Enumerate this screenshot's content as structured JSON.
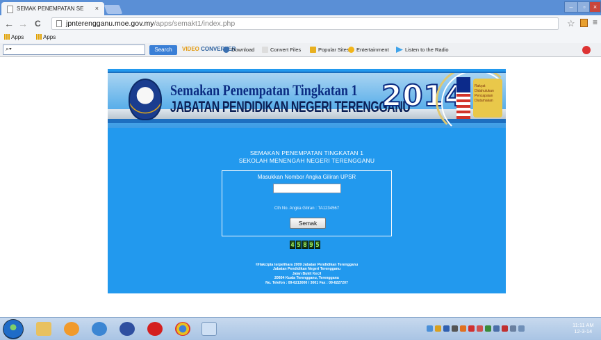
{
  "browser": {
    "tab_title": "SEMAK PENEMPATAN SE",
    "tab_close": "×",
    "url_host": "jpnterengganu.moe.gov.my",
    "url_path": "/apps/semakt1/index.php",
    "back": "←",
    "forward": "→",
    "reload": "C",
    "star": "☆",
    "menu": "≡",
    "bookmarks": [
      "Apps",
      "Apps"
    ]
  },
  "toolbar": {
    "search_box_value": "⌕▾",
    "search_label": "Search",
    "vc_logo_a": "VIDEO",
    "vc_logo_b": "CONVERTER",
    "download": "Download",
    "convert_files": "Convert Files",
    "popular_sites": "Popular Sites",
    "entertainment": "Entertainment",
    "listen_radio": "Listen to the Radio"
  },
  "banner": {
    "title1": "Semakan Penempatan Tingkatan 1",
    "title2": "JABATAN PENDIDIKAN NEGERI TERENGGANU",
    "year": "2014",
    "badge": "Rakyat Didahulukan Pencapaian Diutamakan"
  },
  "page": {
    "heading1": "SEMAKAN PENEMPATAN TINGKATAN 1",
    "heading2": "SEKOLAH MENENGAH NEGERI TERENGGANU",
    "input_label": "Masukkan Nombor Angka Giliran UPSR",
    "input_value": "",
    "example": "Cth No. Angka Giliran : TA1234567",
    "submit": "Semak",
    "counter_digits": [
      "4",
      "5",
      "8",
      "9",
      "5"
    ],
    "footer": [
      "©Hakcipta terpelihara 2009 Jabatan Pendidikan Terengganu",
      "Jabatan Pendidikan Negeri Terengganu",
      "Jalan Bukit Kecil",
      "20604 Kuala Terengganu, Terengganu",
      "No. Telefon : 09-6213000 / 3001 Fax : 09-6227207"
    ]
  },
  "taskbar": {
    "clock_time": "11:11 AM",
    "clock_date": "12-3-14"
  },
  "colors": {
    "page_blue": "#2299ee",
    "titlebar": "#5a8fd6",
    "counter_digit": "#9ef064"
  }
}
